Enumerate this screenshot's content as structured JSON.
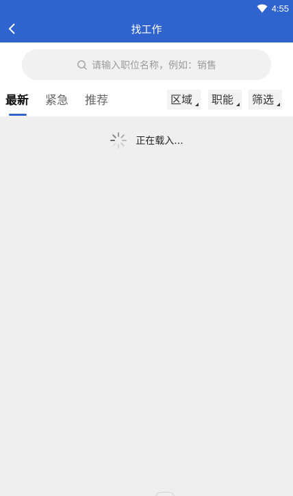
{
  "status_bar": {
    "time": "4:55",
    "wifi_icon": "wifi-icon"
  },
  "header": {
    "title": "找工作",
    "back_icon": "chevron-left-icon"
  },
  "search": {
    "placeholder": "请输入职位名称，例如：销售",
    "icon": "search-icon"
  },
  "tabs": [
    {
      "label": "最新",
      "active": true
    },
    {
      "label": "紧急",
      "active": false
    },
    {
      "label": "推荐",
      "active": false
    }
  ],
  "filters": [
    {
      "label": "区域"
    },
    {
      "label": "职能"
    },
    {
      "label": "筛选"
    }
  ],
  "loading": {
    "text": "正在载入...",
    "icon": "spinner-icon"
  },
  "colors": {
    "brand": "#2f63cd",
    "background": "#efefef"
  }
}
